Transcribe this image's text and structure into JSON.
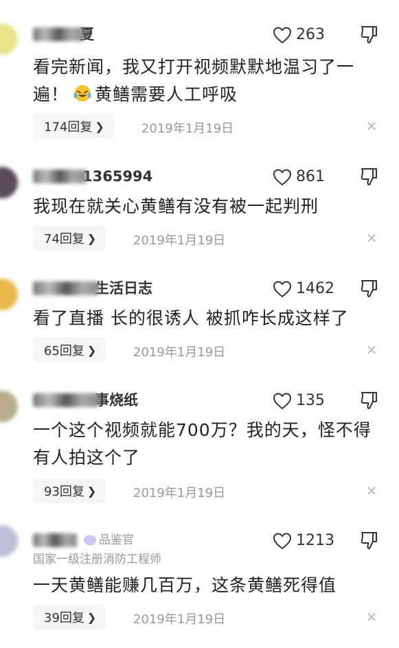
{
  "comments": [
    {
      "user_visible": "夏",
      "badge": "",
      "subtitle": "",
      "likes": "263",
      "text_parts": [
        "看完新闻，我又打开视频默默地温习了一遍！",
        "黄鳝需要人工呼吸"
      ],
      "replies": "174回复",
      "date": "2019年1月19日",
      "avatar_color": "#e8e48a"
    },
    {
      "user_visible": "1365994",
      "badge": "",
      "subtitle": "",
      "likes": "861",
      "text_parts": [
        "我现在就关心黄鳝有没有被一起判刑"
      ],
      "replies": "74回复",
      "date": "2019年1月19日",
      "avatar_color": "#5a4a5c"
    },
    {
      "user_visible": "生活日志",
      "badge": "",
      "subtitle": "",
      "likes": "1462",
      "text_parts": [
        "看了直播 长的很诱人 被抓咋长成这样了"
      ],
      "replies": "65回复",
      "date": "2019年1月19日",
      "avatar_color": "#e8b74a"
    },
    {
      "user_visible": "事烧纸",
      "badge": "",
      "subtitle": "",
      "likes": "135",
      "text_parts": [
        "一个这个视频就能700万？我的天，怪不得有人拍这个了"
      ],
      "replies": "93回复",
      "date": "2019年1月19日",
      "avatar_color": "#b7ad8e"
    },
    {
      "user_visible": "",
      "badge": "品鉴官",
      "subtitle": "国家一级注册消防工程师",
      "likes": "1213",
      "text_parts": [
        "一天黄鳝能赚几百万，这条黄鳝死得值"
      ],
      "replies": "39回复",
      "date": "2019年1月19日",
      "avatar_color": "#b9c0d8"
    }
  ],
  "icons": {
    "reply_chevron": "chevron-right-icon",
    "close": "close-icon",
    "like": "heart-outline-icon",
    "dislike": "thumbs-down-icon",
    "emoji": "laughing-crying-emoji-icon"
  },
  "colors": {
    "text": "#222222",
    "meta": "#999999",
    "pill_bg": "#f5f5f5"
  }
}
